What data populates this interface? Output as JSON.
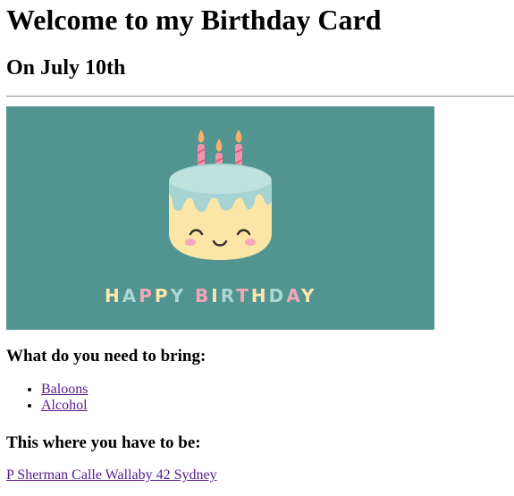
{
  "page": {
    "title": "Welcome to my Birthday Card",
    "subtitle": "On July 10th"
  },
  "card_image": {
    "background": "#52948f",
    "text_letters": [
      "H",
      "A",
      "P",
      "P",
      "Y",
      " ",
      "B",
      "I",
      "R",
      "T",
      "H",
      "D",
      "A",
      "Y"
    ],
    "text_colors": [
      "#fbe7ad",
      "#a9d8d5",
      "#f0a8b8",
      "#fbe7ad",
      "#a9d8d5",
      " ",
      "#f0a8b8",
      "#fbe7ad",
      "#a9d8d5",
      "#f0a8b8",
      "#fbe7ad",
      "#a9d8d5",
      "#f0a8b8",
      "#fbe7ad"
    ],
    "cake_base_color": "#fbe6a8",
    "frosting_color": "#a7d4d2",
    "candle_color": "#f293ab",
    "flame_color": "#f5b06a"
  },
  "bring": {
    "heading": "What do you need to bring:",
    "items": [
      {
        "label": "Baloons"
      },
      {
        "label": "Alcohol"
      }
    ]
  },
  "location": {
    "heading": "This where you have to be:",
    "address": "P Sherman Calle Wallaby 42 Sydney"
  }
}
